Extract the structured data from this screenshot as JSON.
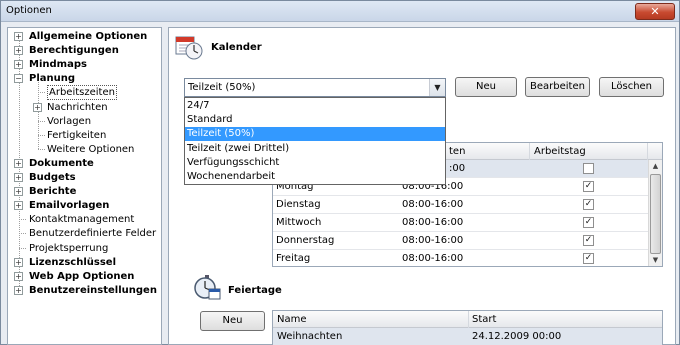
{
  "window": {
    "title": "Optionen",
    "close_glyph": "✕"
  },
  "tree": {
    "items": [
      {
        "label": "Allgemeine Optionen",
        "bold": true,
        "expander": "+"
      },
      {
        "label": "Berechtigungen",
        "bold": true,
        "expander": "+"
      },
      {
        "label": "Mindmaps",
        "bold": true,
        "expander": "+"
      },
      {
        "label": "Planung",
        "bold": true,
        "expander": "−"
      },
      {
        "label": "Arbeitszeiten",
        "bold": false,
        "expander": ""
      },
      {
        "label": "Nachrichten",
        "bold": false,
        "expander": "+"
      },
      {
        "label": "Vorlagen",
        "bold": false,
        "expander": ""
      },
      {
        "label": "Fertigkeiten",
        "bold": false,
        "expander": ""
      },
      {
        "label": "Weitere Optionen",
        "bold": false,
        "expander": ""
      },
      {
        "label": "Dokumente",
        "bold": true,
        "expander": "+"
      },
      {
        "label": "Budgets",
        "bold": true,
        "expander": "+"
      },
      {
        "label": "Berichte",
        "bold": true,
        "expander": "+"
      },
      {
        "label": "Emailvorlagen",
        "bold": true,
        "expander": "+"
      },
      {
        "label": "Kontaktmanagement",
        "bold": false,
        "expander": ""
      },
      {
        "label": "Benutzerdefinierte Felder",
        "bold": false,
        "expander": ""
      },
      {
        "label": "Projektsperrung",
        "bold": false,
        "expander": ""
      },
      {
        "label": "Lizenzschlüssel",
        "bold": true,
        "expander": "+"
      },
      {
        "label": "Web App Optionen",
        "bold": true,
        "expander": "+"
      },
      {
        "label": "Benutzereinstellungen",
        "bold": true,
        "expander": "+"
      }
    ]
  },
  "kalender": {
    "title": "Kalender",
    "icon": "calendar-clock-icon",
    "combo_value": "Teilzeit (50%)",
    "buttons": {
      "new": "Neu",
      "edit": "Bearbeiten",
      "delete": "Löschen"
    },
    "dropdown_options": [
      "24/7",
      "Standard",
      "Teilzeit (50%)",
      "Teilzeit (zwei Drittel)",
      "Verfügungsschicht",
      "Wochenendarbeit"
    ],
    "dropdown_selected": "Teilzeit (50%)"
  },
  "workdays": {
    "columns": [
      "",
      "ten",
      "Arbeitstag"
    ],
    "rows": [
      {
        "day": "",
        "time": ":00",
        "workday": false
      },
      {
        "day": "Montag",
        "time": "08:00-16:00",
        "workday": true
      },
      {
        "day": "Dienstag",
        "time": "08:00-16:00",
        "workday": true
      },
      {
        "day": "Mittwoch",
        "time": "08:00-16:00",
        "workday": true
      },
      {
        "day": "Donnerstag",
        "time": "08:00-16:00",
        "workday": true
      },
      {
        "day": "Freitag",
        "time": "08:00-16:00",
        "workday": true
      },
      {
        "day": "",
        "time": "",
        "workday": false
      }
    ]
  },
  "feiertage": {
    "title": "Feiertage",
    "icon": "stopwatch-calendar-icon",
    "new_button": "Neu",
    "columns": [
      "Name",
      "Start"
    ],
    "rows": [
      {
        "name": "Weihnachten",
        "start": "24.12.2009 00:00"
      }
    ]
  },
  "colors": {
    "selection": "#3399ff",
    "row_highlight": "#dfe5ee"
  }
}
